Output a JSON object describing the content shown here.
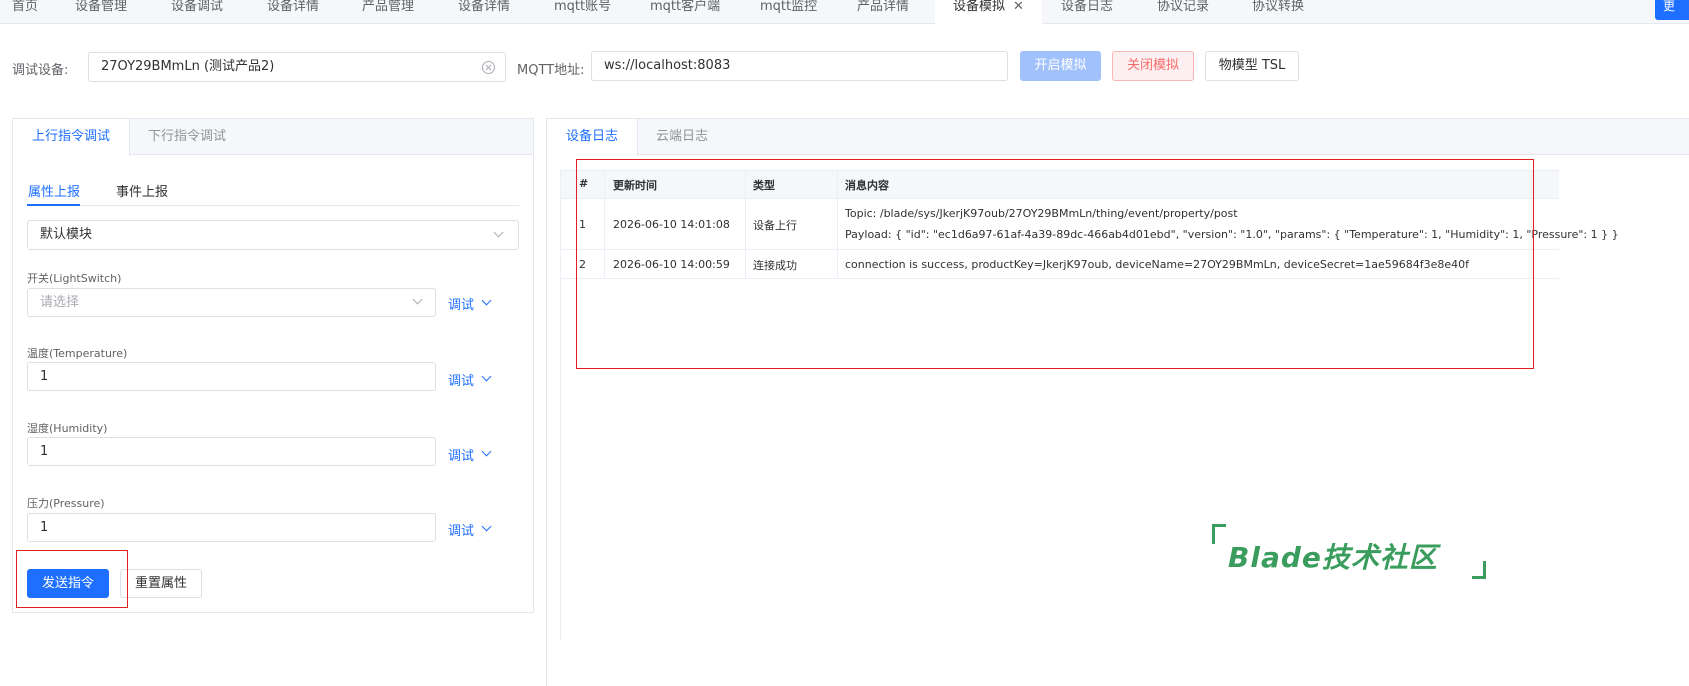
{
  "top_tabs": [
    "首页",
    "设备管理",
    "设备调试",
    "设备详情",
    "产品管理",
    "设备详情",
    "mqtt账号",
    "mqtt客户端",
    "mqtt监控",
    "产品详情",
    "设备模拟",
    "设备日志",
    "协议记录",
    "协议转换"
  ],
  "active_top_tab": "设备模拟",
  "top_right_button": "更",
  "toolbar": {
    "device_label": "调试设备:",
    "device_value": "27OY29BMmLn (测试产品2)",
    "mqtt_label": "MQTT地址:",
    "mqtt_value": "ws://localhost:8083",
    "start_button": "开启模拟",
    "stop_button": "关闭模拟",
    "tsl_button": "物模型 TSL"
  },
  "left_panel": {
    "tabs": [
      "上行指令调试",
      "下行指令调试"
    ],
    "active_tab": "上行指令调试",
    "sub_tabs": [
      "属性上报",
      "事件上报"
    ],
    "active_sub_tab": "属性上报",
    "module_select": "默认模块",
    "fields": [
      {
        "label": "开关(LightSwitch)",
        "value": "",
        "placeholder": "请选择",
        "type": "select",
        "action": "调试"
      },
      {
        "label": "温度(Temperature)",
        "value": "1",
        "placeholder": "",
        "type": "input",
        "action": "调试"
      },
      {
        "label": "湿度(Humidity)",
        "value": "1",
        "placeholder": "",
        "type": "input",
        "action": "调试"
      },
      {
        "label": "压力(Pressure)",
        "value": "1",
        "placeholder": "",
        "type": "input",
        "action": "调试"
      }
    ],
    "send_button": "发送指令",
    "reset_button": "重置属性"
  },
  "right_panel": {
    "tabs": [
      "设备日志",
      "云端日志"
    ],
    "active_tab": "设备日志",
    "table": {
      "headers": [
        "#",
        "更新时间",
        "类型",
        "消息内容"
      ],
      "rows": [
        {
          "index": "1",
          "time": "2026-06-10 14:01:08",
          "type": "设备上行",
          "content_line1": "Topic: /blade/sys/JkerjK97oub/27OY29BMmLn/thing/event/property/post",
          "content_line2": "Payload: { \"id\": \"ec1d6a97-61af-4a39-89dc-466ab4d01ebd\", \"version\": \"1.0\", \"params\": { \"Temperature\": 1, \"Humidity\": 1, \"Pressure\": 1 } }"
        },
        {
          "index": "2",
          "time": "2026-06-10 14:00:59",
          "type": "连接成功",
          "content_line1": "connection is success, productKey=JkerjK97oub, deviceName=27OY29BMmLn, deviceSecret=1ae59684f3e8e40f",
          "content_line2": ""
        }
      ]
    }
  },
  "watermark": "Blade技术社区",
  "colors": {
    "primary": "#1e6fff",
    "danger": "#f56c6c",
    "highlight_box": "#e02020",
    "watermark": "#3a9d5d"
  }
}
